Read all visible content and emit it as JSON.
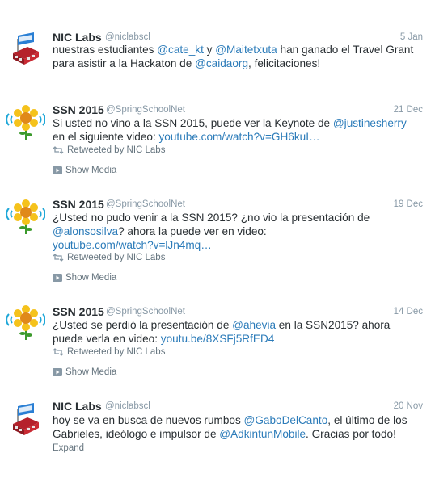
{
  "tweets": [
    {
      "author": "NIC Labs",
      "handle": "@niclabscl",
      "date": "5 Jan",
      "avatar_icon": "nic-labs-building-icon",
      "lines": [
        [
          {
            "t": "nuestras estudiantes "
          },
          {
            "t": "@cate_kt",
            "m": 1
          },
          {
            "t": " y "
          },
          {
            "t": "@Maitetxuta",
            "m": 1
          },
          {
            "t": " han ganado el Travel Grant"
          }
        ],
        [
          {
            "t": "para asistir a la Hackaton de "
          },
          {
            "t": "@caidaorg",
            "m": 1
          },
          {
            "t": ", felicitaciones!"
          }
        ]
      ]
    },
    {
      "author": "SSN 2015",
      "handle": "@SpringSchoolNet",
      "date": "21 Dec",
      "avatar_icon": "ssn-sunflower-icon",
      "lines": [
        [
          {
            "t": "Si usted no vino a la SSN 2015, puede ver la Keynote de "
          },
          {
            "t": "@justinesherry",
            "m": 1
          }
        ],
        [
          {
            "t": "en el siguiente video: "
          },
          {
            "t": "youtube.com/watch?v=GH6kuI…",
            "l": 1
          }
        ]
      ],
      "retweet_text": "Retweeted by NIC Labs",
      "media_text": "Show Media"
    },
    {
      "author": "SSN 2015",
      "handle": "@SpringSchoolNet",
      "date": "19 Dec",
      "avatar_icon": "ssn-sunflower-icon",
      "lines": [
        [
          {
            "t": "¿Usted no pudo venir a la SSN 2015? ¿no vio la presentación de"
          }
        ],
        [
          {
            "t": "@alonsosilva",
            "m": 1
          },
          {
            "t": "? ahora la puede ver en video:"
          }
        ],
        [
          {
            "t": "youtube.com/watch?v=lJn4mq…",
            "l": 1
          }
        ]
      ],
      "retweet_text": "Retweeted by NIC Labs",
      "media_text": "Show Media"
    },
    {
      "author": "SSN 2015",
      "handle": "@SpringSchoolNet",
      "date": "14 Dec",
      "avatar_icon": "ssn-sunflower-icon",
      "lines": [
        [
          {
            "t": "¿Usted se perdió la presentación de "
          },
          {
            "t": "@ahevia",
            "m": 1
          },
          {
            "t": " en la SSN2015? ahora"
          }
        ],
        [
          {
            "t": "puede verla en video: "
          },
          {
            "t": "youtu.be/8XSFj5RfED4",
            "l": 1
          }
        ]
      ],
      "retweet_text": "Retweeted by NIC Labs",
      "media_text": "Show Media"
    },
    {
      "author": "NIC Labs",
      "handle": "@niclabscl",
      "date": "20 Nov",
      "avatar_icon": "nic-labs-building-icon",
      "lines": [
        [
          {
            "t": "hoy se va en busca de nuevos rumbos "
          },
          {
            "t": "@GaboDelCanto",
            "m": 1
          },
          {
            "t": ", el último de los"
          }
        ],
        [
          {
            "t": "Gabrieles, ideólogo e impulsor de "
          },
          {
            "t": "@AdkintunMobile",
            "m": 1
          },
          {
            "t": ". Gracias por todo!"
          }
        ]
      ],
      "expand_text": "Expand"
    }
  ],
  "colors": {
    "link": "#2b7bb9",
    "muted": "#8899a6",
    "text": "#292f33"
  }
}
